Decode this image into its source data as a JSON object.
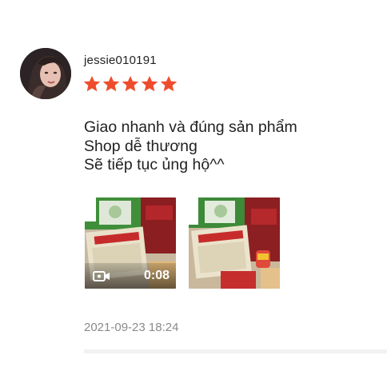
{
  "review": {
    "username": "jessie010191",
    "rating": 5,
    "rating_max": 5,
    "star_color": "#ee4d2d",
    "comment_lines": [
      "Giao nhanh và đúng sản phẩm",
      "Shop dễ thương",
      "Sẽ tiếp tục ủng hộ^^"
    ],
    "media": {
      "video_duration": "0:08",
      "video_icon": "video-camera-icon"
    },
    "timestamp": "2021-09-23 18:24"
  }
}
